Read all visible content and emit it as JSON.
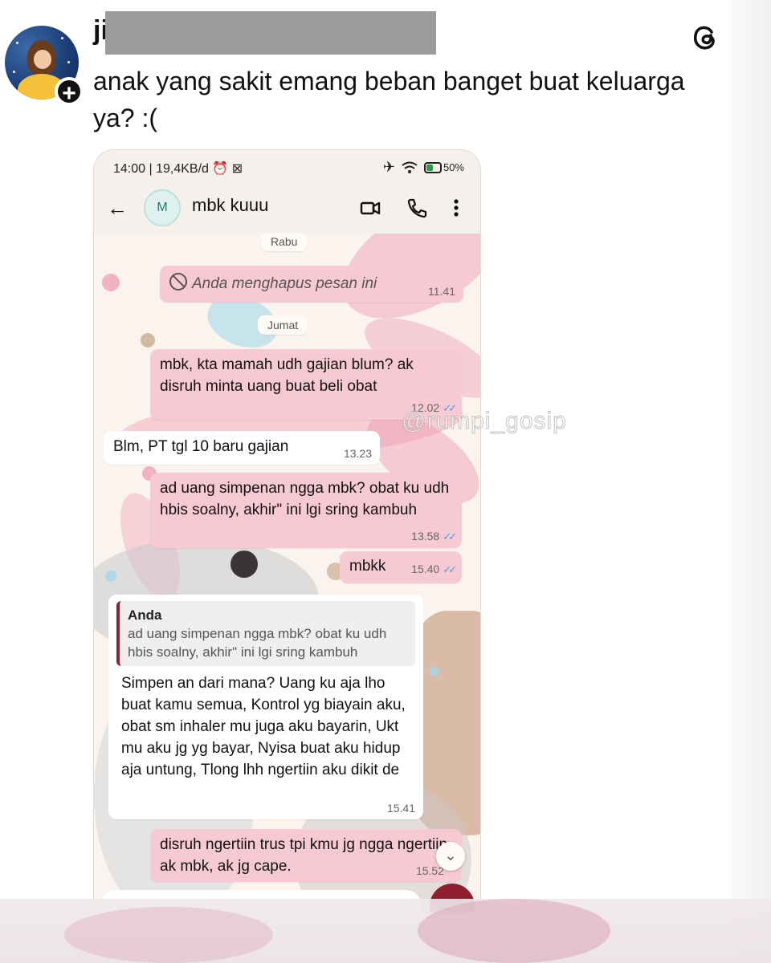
{
  "post": {
    "username": "ji",
    "text": "anak yang sakit emang beban banget buat keluarga ya? :(",
    "follow_badge": "+"
  },
  "phone": {
    "status": {
      "left": "14:00 | 19,4KB/d",
      "battery": "50%"
    },
    "chat": {
      "contact_initial": "M",
      "contact_name": "mbk kuuu"
    },
    "messages": {
      "date1": "Rabu",
      "deleted_text": "Anda menghapus pesan ini",
      "deleted_time": "11.41",
      "date2": "Jumat",
      "m1_text": "mbk, kta mamah udh gajian blum? ak disruh minta uang buat beli obat",
      "m1_time": "12.02",
      "m2_text": "Blm, PT tgl 10 baru gajian",
      "m2_time": "13.23",
      "m3_text": "ad uang simpenan ngga mbk? obat ku udh hbis soalny, akhir\" ini lgi sring kambuh",
      "m3_time": "13.58",
      "m4_text": "mbkk",
      "m4_time": "15.40",
      "m5_quote_name": "Anda",
      "m5_quote_text": "ad uang simpenan ngga mbk? obat ku udh hbis soalny, akhir\" ini lgi sring kambuh",
      "m5_text": "Simpen an dari mana? Uang ku aja lho buat kamu semua, Kontrol yg biayain aku, obat sm inhaler mu juga aku bayarin, Ukt mu aku jg yg bayar, Nyisa buat aku hidup aja untung, Tlong lhh ngertiin aku dikit de",
      "m5_time": "15.41",
      "m6_text": "disruh ngertiin trus tpi kmu jg ngga ngertiin ak mbk, ak jg cape.",
      "m6_time": "15.52",
      "read_ticks": "✓✓"
    },
    "watermark": "@rumpi_gosip"
  }
}
